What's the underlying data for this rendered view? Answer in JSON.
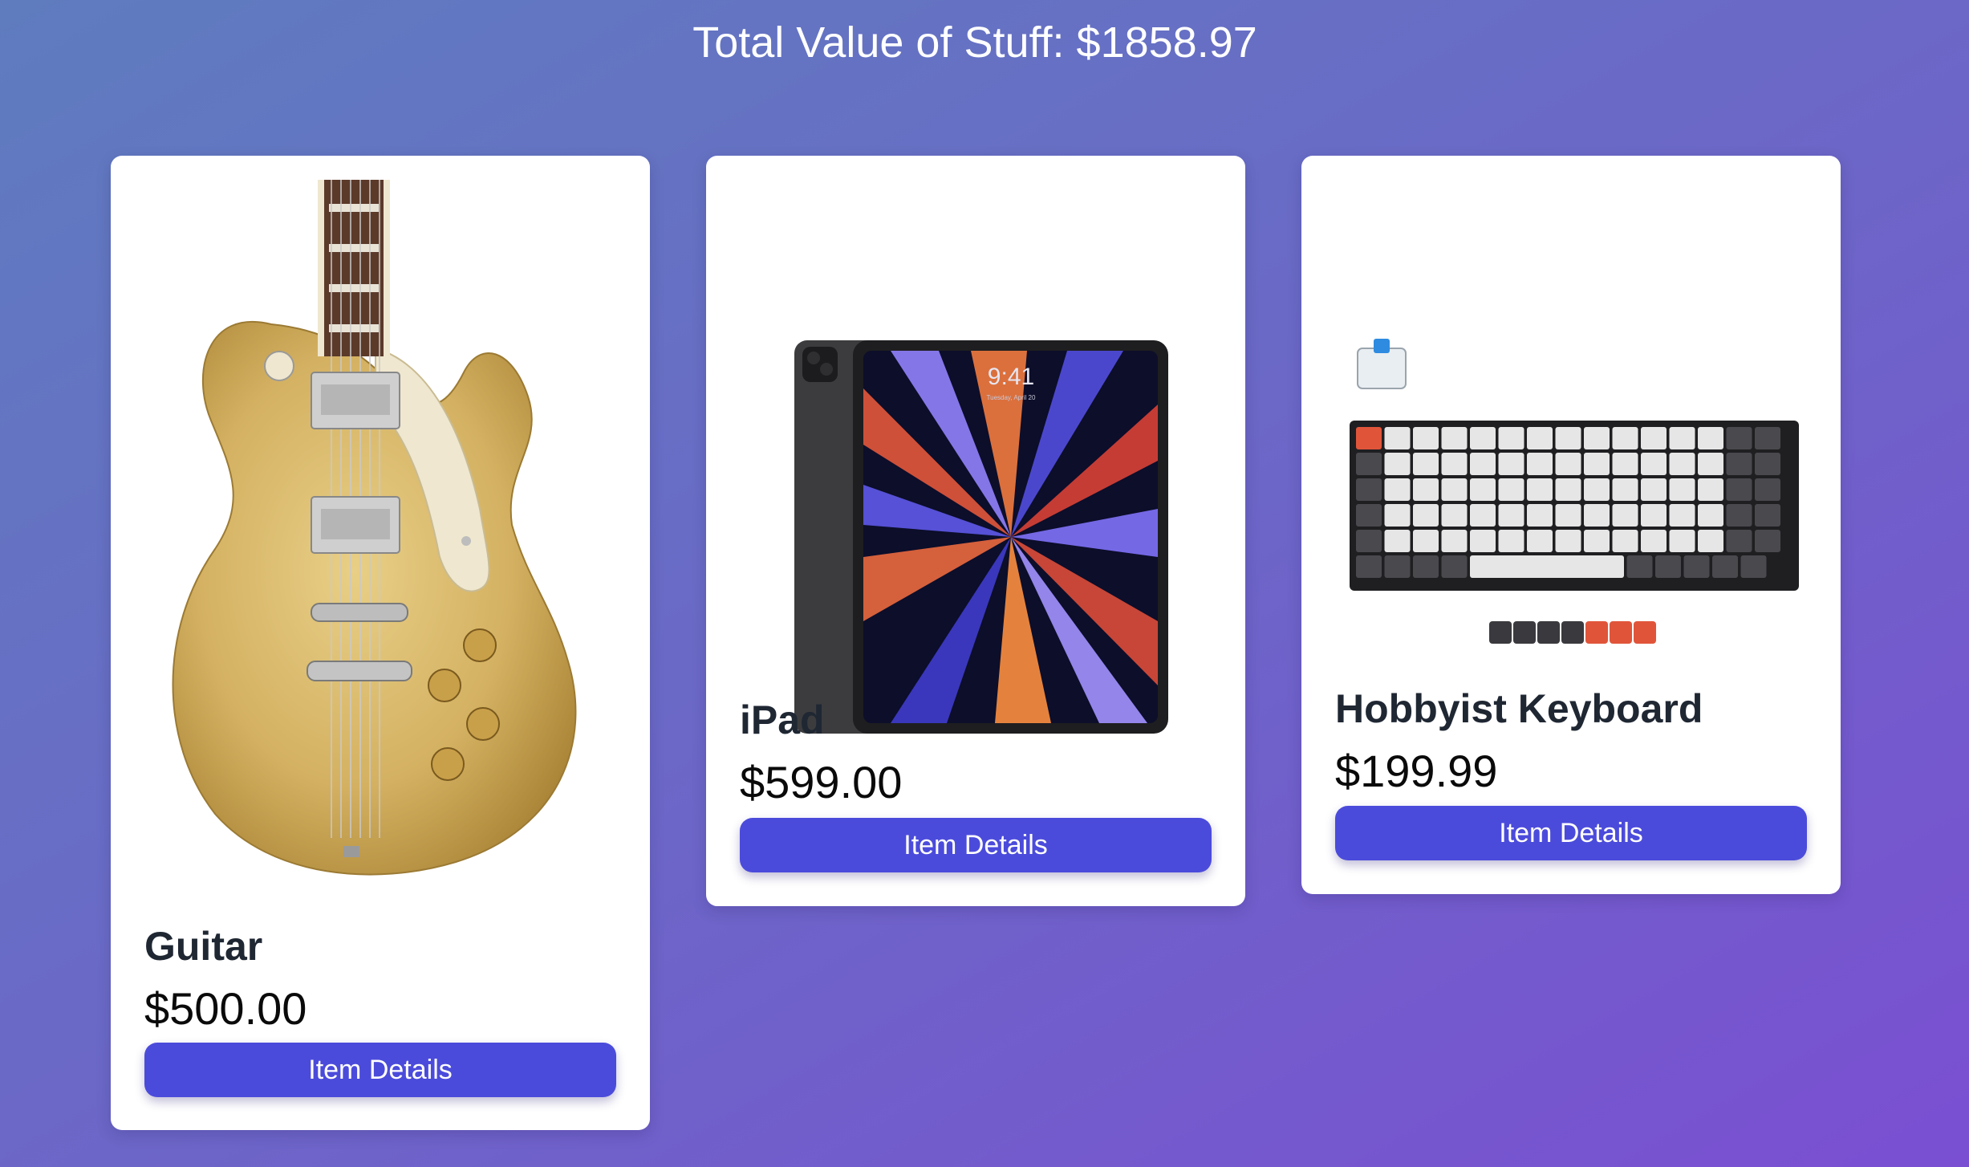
{
  "header": {
    "title": "Total Value of Stuff: $1858.97"
  },
  "colors": {
    "button": "#4b4bdb",
    "background_start": "#5f7cbf",
    "background_end": "#7a4fd2"
  },
  "items": [
    {
      "name": "Guitar",
      "price": "$500.00",
      "button_label": "Item Details",
      "image": "gold-electric-guitar"
    },
    {
      "name": "iPad",
      "price": "$599.00",
      "button_label": "Item Details",
      "image": "ipad-pro",
      "screen_time": "9:41",
      "screen_date": "Tuesday, April 20"
    },
    {
      "name": "Hobbyist Keyboard",
      "price": "$199.99",
      "button_label": "Item Details",
      "image": "mechanical-keyboard-with-keycaps"
    }
  ]
}
